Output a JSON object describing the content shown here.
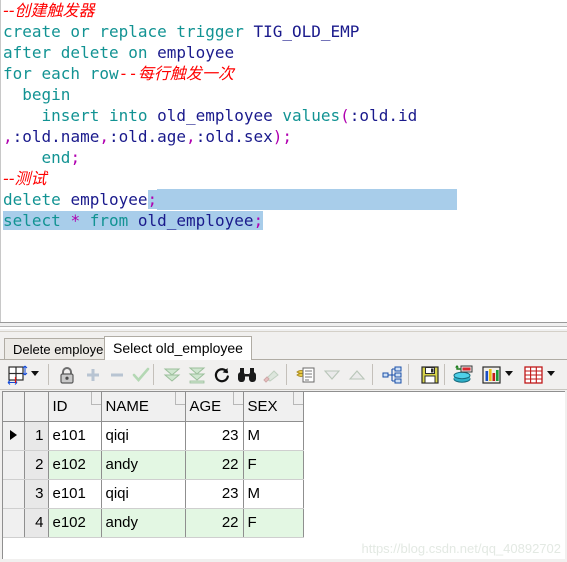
{
  "editor": {
    "lines": [
      {
        "id": "l1",
        "segments": [
          {
            "t": "--创建触发器",
            "c": "cm"
          }
        ]
      },
      {
        "id": "l2",
        "segments": [
          {
            "t": "create or replace trigger ",
            "c": "kw"
          },
          {
            "t": "TIG_OLD_EMP",
            "c": "id"
          }
        ]
      },
      {
        "id": "l3",
        "segments": [
          {
            "t": "after delete on ",
            "c": "kw"
          },
          {
            "t": "employee",
            "c": "id"
          }
        ]
      },
      {
        "id": "l4",
        "segments": [
          {
            "t": "for each row",
            "c": "kw"
          },
          {
            "t": "--",
            "c": "cmm"
          },
          {
            "t": "每行触发一次",
            "c": "cm"
          }
        ]
      },
      {
        "id": "l5",
        "segments": [
          {
            "t": "  begin",
            "c": "kw"
          }
        ]
      },
      {
        "id": "l6",
        "segments": [
          {
            "t": "    insert into ",
            "c": "kw"
          },
          {
            "t": "old_employee",
            "c": "id"
          },
          {
            "t": " ",
            "c": "kw"
          },
          {
            "t": "values",
            "c": "kw"
          },
          {
            "t": "(",
            "c": "pn"
          },
          {
            "t": ":old.id",
            "c": "id"
          }
        ]
      },
      {
        "id": "l7",
        "segments": [
          {
            "t": ",",
            "c": "pn"
          },
          {
            "t": ":old.name",
            "c": "id"
          },
          {
            "t": ",",
            "c": "pn"
          },
          {
            "t": ":old.age",
            "c": "id"
          },
          {
            "t": ",",
            "c": "pn"
          },
          {
            "t": ":old.sex",
            "c": "id"
          },
          {
            "t": ");",
            "c": "pn"
          }
        ]
      },
      {
        "id": "l8",
        "segments": [
          {
            "t": "    end",
            "c": "kw"
          },
          {
            "t": ";",
            "c": "pn"
          }
        ]
      },
      {
        "id": "l9",
        "segments": [
          {
            "t": "--测试",
            "c": "cm"
          }
        ]
      },
      {
        "id": "l10",
        "segments": [
          {
            "t": "delete ",
            "c": "kw"
          },
          {
            "t": "employee",
            "c": "id"
          },
          {
            "t": ";",
            "c": "pn",
            "sel": true
          }
        ],
        "trailing_select": true
      },
      {
        "id": "l11",
        "segments": [
          {
            "t": "select ",
            "c": "kw",
            "sel": true
          },
          {
            "t": "*",
            "c": "pn",
            "sel": true
          },
          {
            "t": " from ",
            "c": "kw",
            "sel": true
          },
          {
            "t": "old_employee",
            "c": "id",
            "sel": true
          },
          {
            "t": ";",
            "c": "pn",
            "sel": true
          }
        ]
      }
    ],
    "selection_color": "#a8cdea"
  },
  "result_pane": {
    "tabs": [
      {
        "label": "Delete employee",
        "active": false
      },
      {
        "label": "Select old_employee",
        "active": true
      }
    ],
    "toolbar": {
      "items": [
        {
          "name": "grid-layout-icon",
          "enabled": true
        },
        {
          "name": "grid-layout-dropdown",
          "enabled": true
        },
        {
          "name": "lock-icon",
          "enabled": true
        },
        {
          "name": "add-record-icon",
          "enabled": false
        },
        {
          "name": "remove-record-icon",
          "enabled": false
        },
        {
          "name": "post-edit-icon",
          "enabled": false
        },
        {
          "name": "fetch-next-page-icon",
          "enabled": false
        },
        {
          "name": "fetch-last-page-icon",
          "enabled": false
        },
        {
          "name": "refresh-icon",
          "enabled": true
        },
        {
          "name": "find-icon",
          "enabled": true
        },
        {
          "name": "highlight-icon",
          "enabled": false
        },
        {
          "name": "copy-records-icon",
          "enabled": true
        },
        {
          "name": "sort-descending-icon",
          "enabled": false
        },
        {
          "name": "sort-ascending-icon",
          "enabled": false
        },
        {
          "name": "query-plan-icon",
          "enabled": true
        },
        {
          "name": "save-icon",
          "enabled": true
        },
        {
          "name": "export-data-icon",
          "enabled": true
        },
        {
          "name": "chart-icon",
          "enabled": true
        },
        {
          "name": "chart-dropdown",
          "enabled": true
        },
        {
          "name": "table-icon",
          "enabled": true
        },
        {
          "name": "table-dropdown",
          "enabled": true
        }
      ]
    },
    "grid": {
      "columns": [
        "ID",
        "NAME",
        "AGE",
        "SEX"
      ],
      "rows": [
        {
          "n": "1",
          "ID": "e101",
          "NAME": "qiqi",
          "AGE": "23",
          "SEX": "M",
          "current": true
        },
        {
          "n": "2",
          "ID": "e102",
          "NAME": "andy",
          "AGE": "22",
          "SEX": "F",
          "current": false
        },
        {
          "n": "3",
          "ID": "e101",
          "NAME": "qiqi",
          "AGE": "23",
          "SEX": "M",
          "current": false
        },
        {
          "n": "4",
          "ID": "e102",
          "NAME": "andy",
          "AGE": "22",
          "SEX": "F",
          "current": false
        }
      ],
      "alt_row_color": "#e3f7e3",
      "row_color": "#ffffff"
    }
  },
  "watermark": {
    "text": "https://blog.csdn.net/qq_40892702"
  }
}
